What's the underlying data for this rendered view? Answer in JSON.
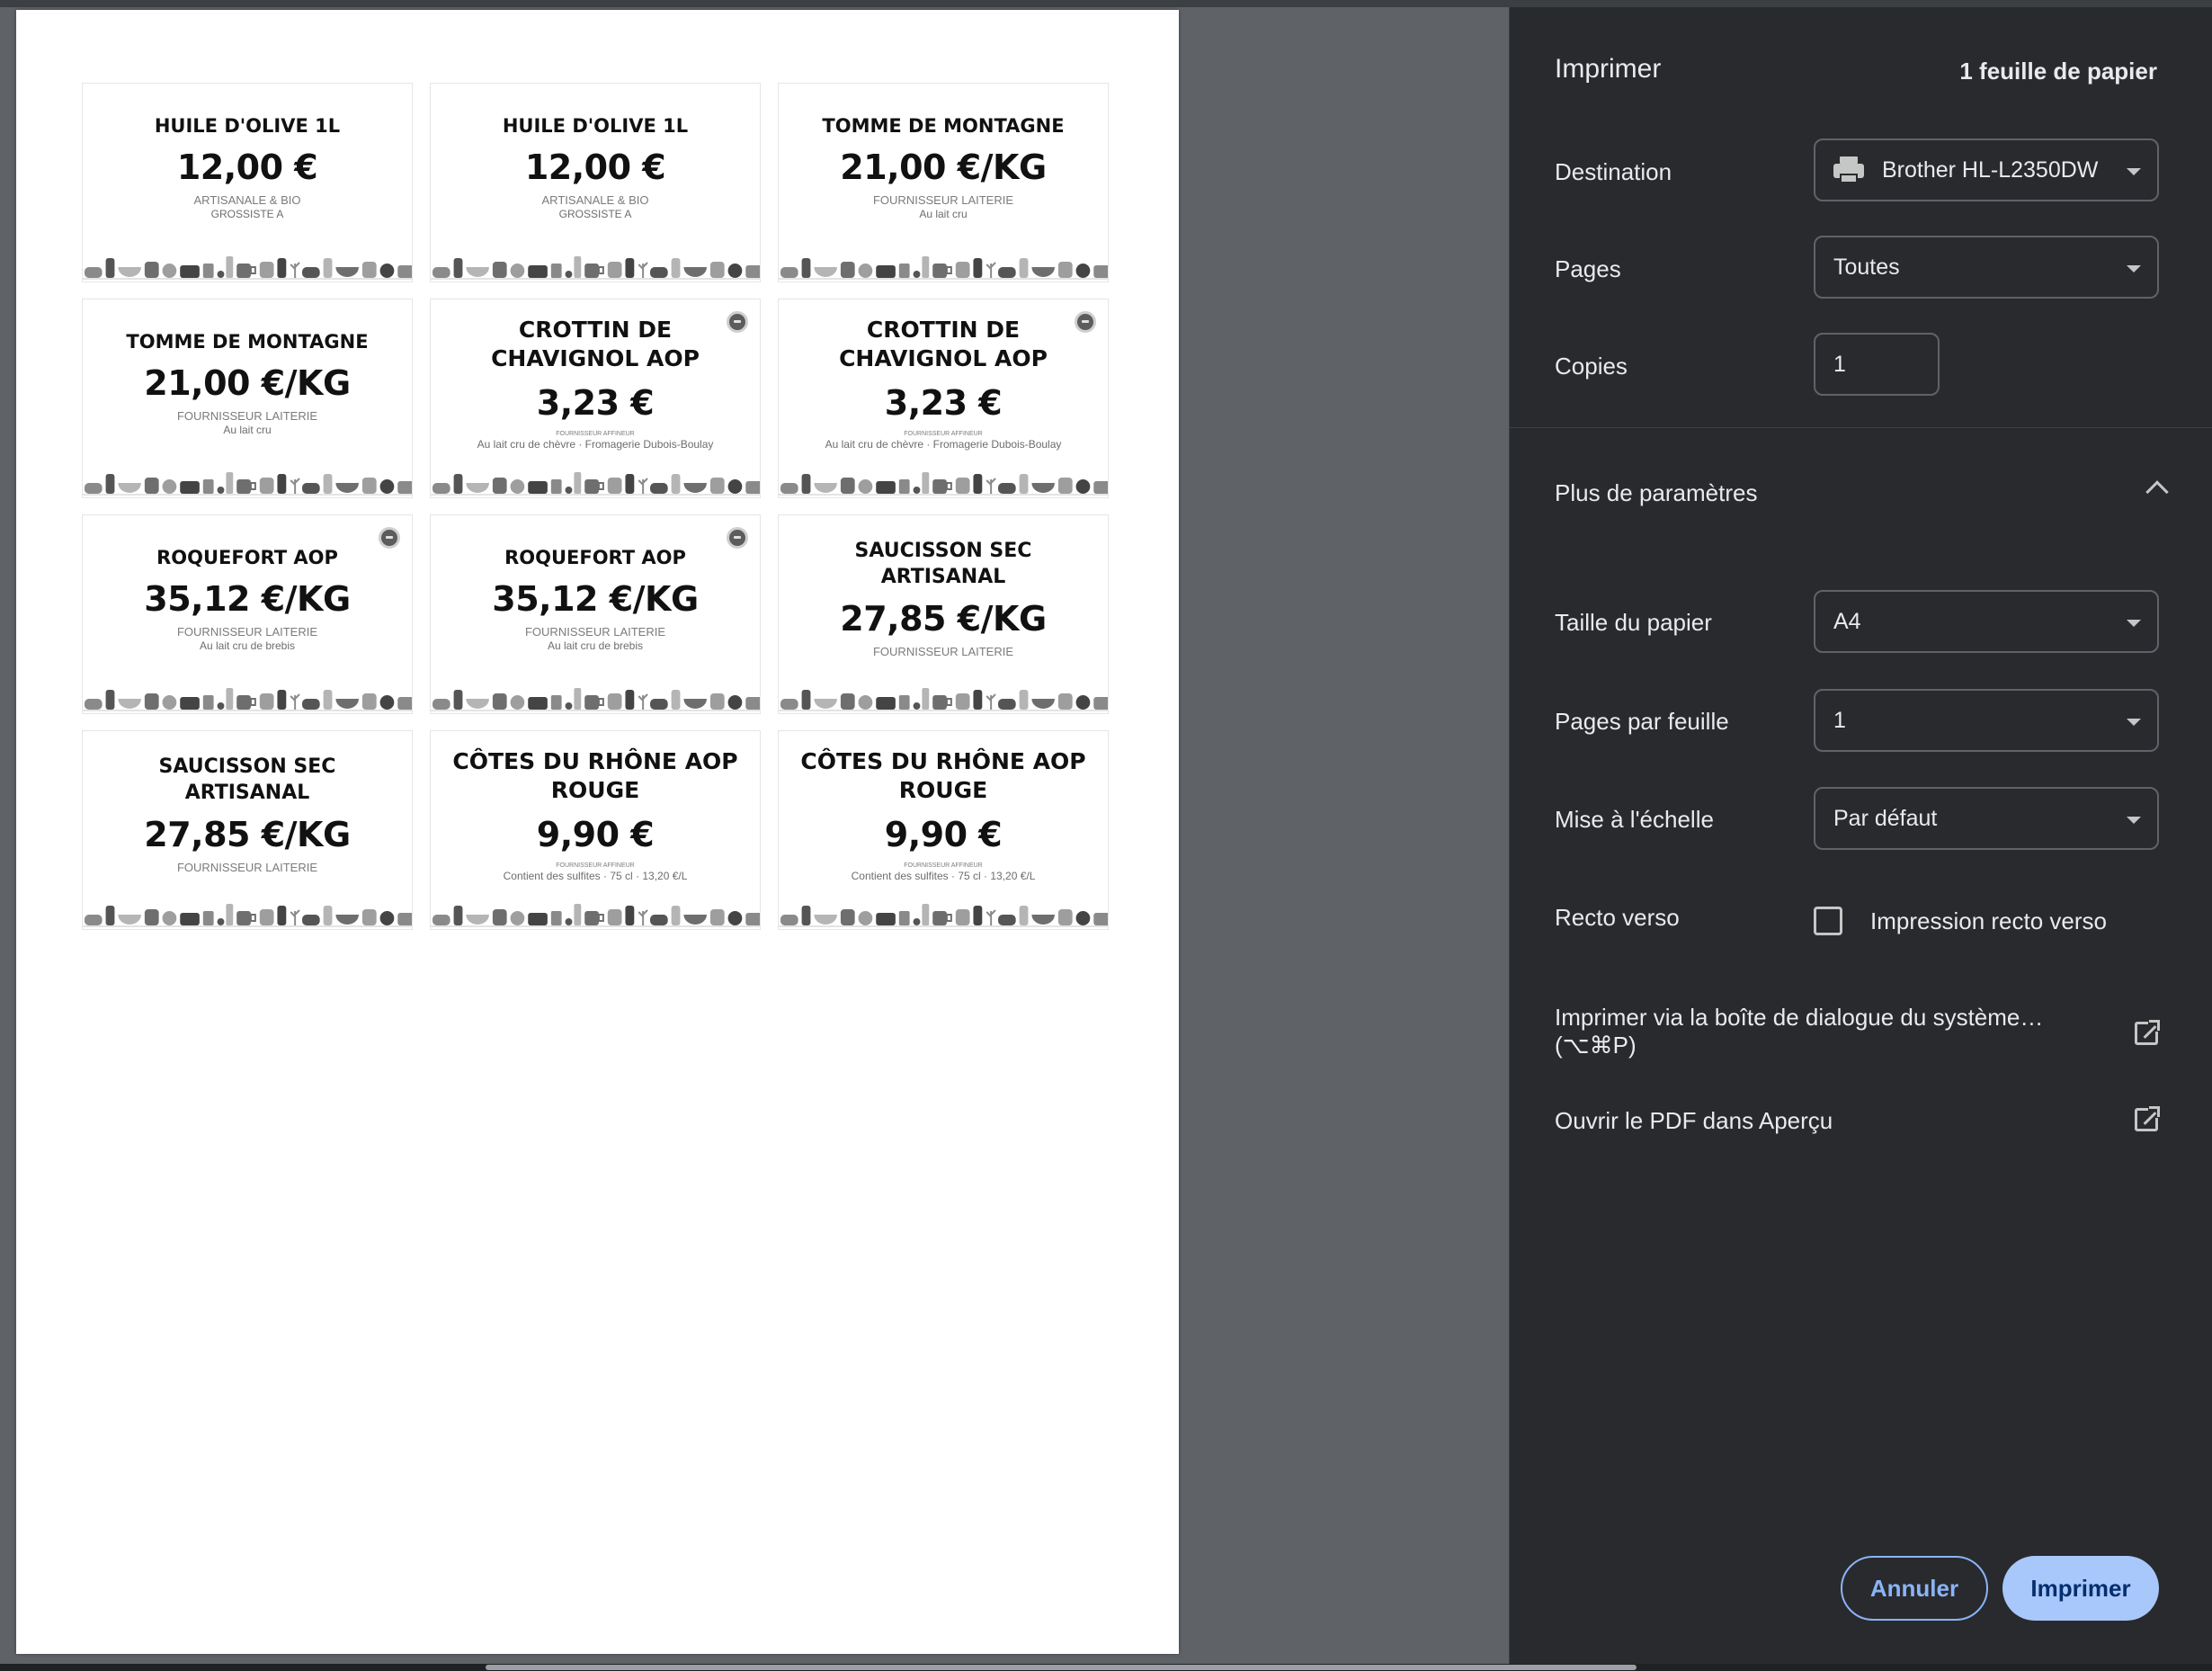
{
  "preview": {
    "labels": [
      {
        "title": "HUILE D'OLIVE 1L",
        "price": "12,00 €",
        "sub": "ARTISANALE & BIO",
        "detail": "GROSSISTE A",
        "size": "sm",
        "badge": false,
        "tiny": false
      },
      {
        "title": "HUILE D'OLIVE 1L",
        "price": "12,00 €",
        "sub": "ARTISANALE & BIO",
        "detail": "GROSSISTE A",
        "size": "sm",
        "badge": false,
        "tiny": false
      },
      {
        "title": "TOMME DE MONTAGNE",
        "price": "21,00 €/KG",
        "sub": "FOURNISSEUR LAITERIE",
        "detail": "Au lait cru",
        "size": "sm",
        "badge": false,
        "tiny": false
      },
      {
        "title": "TOMME DE MONTAGNE",
        "price": "21,00 €/KG",
        "sub": "FOURNISSEUR LAITERIE",
        "detail": "Au lait cru",
        "size": "sm",
        "badge": false,
        "tiny": false
      },
      {
        "title": "CROTTIN DE CHAVIGNOL AOP",
        "price": "3,23 €",
        "sub": "FOURNISSEUR AFFINEUR",
        "detail": "Au lait cru de chèvre · Fromagerie Dubois-Boulay",
        "size": "lg",
        "badge": true,
        "tiny": true
      },
      {
        "title": "CROTTIN DE CHAVIGNOL AOP",
        "price": "3,23 €",
        "sub": "FOURNISSEUR AFFINEUR",
        "detail": "Au lait cru de chèvre · Fromagerie Dubois-Boulay",
        "size": "lg",
        "badge": true,
        "tiny": true
      },
      {
        "title": "ROQUEFORT AOP",
        "price": "35,12 €/KG",
        "sub": "FOURNISSEUR LAITERIE",
        "detail": "Au lait cru de brebis",
        "size": "sm",
        "badge": true,
        "tiny": false
      },
      {
        "title": "ROQUEFORT AOP",
        "price": "35,12 €/KG",
        "sub": "FOURNISSEUR LAITERIE",
        "detail": "Au lait cru de brebis",
        "size": "sm",
        "badge": true,
        "tiny": false
      },
      {
        "title": "SAUCISSON SEC ARTISANAL",
        "price": "27,85 €/KG",
        "sub": "FOURNISSEUR LAITERIE",
        "detail": "",
        "size": "md",
        "badge": false,
        "tiny": false
      },
      {
        "title": "SAUCISSON SEC ARTISANAL",
        "price": "27,85 €/KG",
        "sub": "FOURNISSEUR LAITERIE",
        "detail": "",
        "size": "md",
        "badge": false,
        "tiny": false
      },
      {
        "title": "CÔTES DU RHÔNE AOP ROUGE",
        "price": "9,90 €",
        "sub": "FOURNISSEUR AFFINEUR",
        "detail": "Contient des sulfites · 75 cl · 13,20 €/L",
        "size": "lg",
        "badge": false,
        "tiny": true
      },
      {
        "title": "CÔTES DU RHÔNE AOP ROUGE",
        "price": "9,90 €",
        "sub": "FOURNISSEUR AFFINEUR",
        "detail": "Contient des sulfites · 75 cl · 13,20 €/L",
        "size": "lg",
        "badge": false,
        "tiny": true
      }
    ]
  },
  "sidebar": {
    "title": "Imprimer",
    "sheets": "1 feuille de papier",
    "destination": {
      "label": "Destination",
      "value": "Brother HL-L2350DW",
      "icon": "printer-icon"
    },
    "pages": {
      "label": "Pages",
      "value": "Toutes"
    },
    "copies": {
      "label": "Copies",
      "value": "1"
    },
    "more_settings": "Plus de paramètres",
    "paper_size": {
      "label": "Taille du papier",
      "value": "A4"
    },
    "pages_per_sheet": {
      "label": "Pages par feuille",
      "value": "1"
    },
    "scale": {
      "label": "Mise à l'échelle",
      "value": "Par défaut"
    },
    "duplex": {
      "label": "Recto verso",
      "option": "Impression recto verso",
      "checked": false
    },
    "system_dialog": "Imprimer via la boîte de dialogue du système… (⌥⌘P)",
    "open_pdf": "Ouvrir le PDF dans Aperçu",
    "cancel": "Annuler",
    "print": "Imprimer"
  },
  "colors": {
    "sidebar_bg": "#292a2d",
    "preview_bg": "#5f6368",
    "accent": "#8ab4f8",
    "print_button": "#a8c7fa"
  }
}
